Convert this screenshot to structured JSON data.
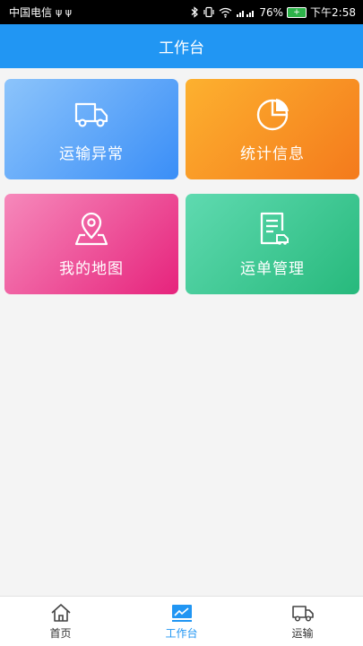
{
  "status_bar": {
    "carrier": "中国电信",
    "usb_glyphs": "ψ ψ",
    "battery_percent": "76%",
    "time": "下午2:58"
  },
  "header": {
    "title": "工作台"
  },
  "tiles": [
    {
      "label": "运输异常",
      "icon": "truck-icon",
      "color_start": "#8cc4fb",
      "color_end": "#3a8ef7"
    },
    {
      "label": "统计信息",
      "icon": "pie-chart-icon",
      "color_start": "#fdb12f",
      "color_end": "#f47a1c"
    },
    {
      "label": "我的地图",
      "icon": "map-pin-icon",
      "color_start": "#f689bb",
      "color_end": "#e6237c"
    },
    {
      "label": "运单管理",
      "icon": "waybill-icon",
      "color_start": "#5fdab0",
      "color_end": "#27b97c"
    }
  ],
  "bottom_nav": {
    "items": [
      {
        "label": "首页",
        "icon": "home-icon",
        "active": false
      },
      {
        "label": "工作台",
        "icon": "dashboard-icon",
        "active": true
      },
      {
        "label": "运输",
        "icon": "truck-icon",
        "active": false
      }
    ],
    "active_color": "#2196f3"
  }
}
